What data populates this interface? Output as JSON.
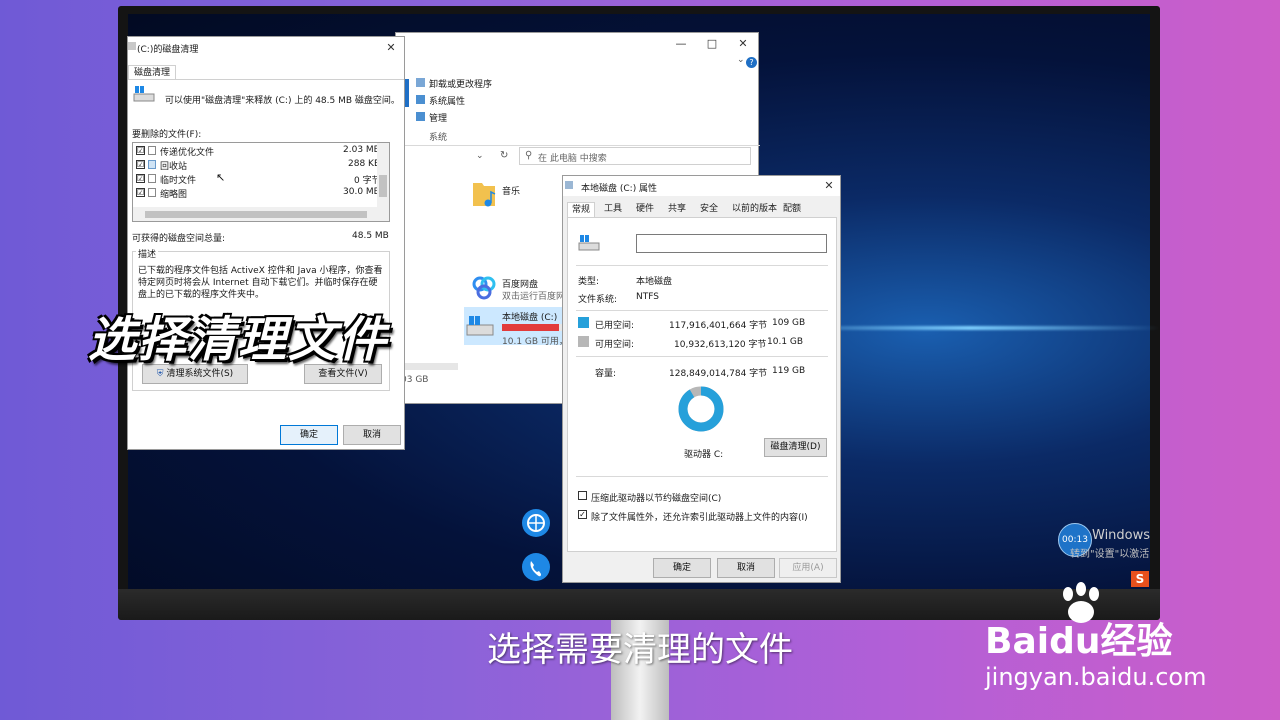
{
  "disk_cleanup": {
    "title": "(C:)的磁盘清理",
    "tab": "磁盘清理",
    "intro": "可以使用\"磁盘清理\"来释放  (C:) 上的 48.5 MB 磁盘空间。",
    "files_label": "要删除的文件(F):",
    "files": [
      {
        "name": "传递优化文件",
        "size": "2.03 MB",
        "checked": "☑"
      },
      {
        "name": "回收站",
        "size": "288 KB",
        "checked": "☑"
      },
      {
        "name": "临时文件",
        "size": "0 字节",
        "checked": "☑"
      },
      {
        "name": "缩略图",
        "size": "30.0 MB",
        "checked": "☑"
      }
    ],
    "total_label": "可获得的磁盘空间总量:",
    "total_value": "48.5 MB",
    "desc_label": "描述",
    "desc_text": "已下载的程序文件包括 ActiveX 控件和 Java 小程序，你查看特定网页时将会从 Internet 自动下载它们。并临时保存在硬盘上的已下载的程序文件夹中。",
    "clean_system_btn": "清理系统文件(S)",
    "view_files_btn": "查看文件(V)",
    "ok_btn": "确定",
    "cancel_btn": "取消"
  },
  "explorer": {
    "ribbon_items": [
      "卸载或更改程序",
      "系统属性",
      "管理"
    ],
    "ribbon_group": "系统",
    "search_placeholder": "在 此电脑 中搜索",
    "music": "音乐",
    "baidu_name": "百度网盘",
    "baidu_sub": "双击运行百度网",
    "disk_name": "本地磁盘 (C:)",
    "disk_free": "10.1 GB 可用，",
    "disk_free_partial": "03 GB",
    "disk_usage": 0.92
  },
  "properties": {
    "title": "本地磁盘 (C:) 属性",
    "tabs": [
      "常规",
      "工具",
      "硬件",
      "共享",
      "安全",
      "以前的版本",
      "配额"
    ],
    "type_label": "类型:",
    "type_value": "本地磁盘",
    "fs_label": "文件系统:",
    "fs_value": "NTFS",
    "used_label": "已用空间:",
    "used_bytes": "117,916,401,664 字节",
    "used_gb": "109 GB",
    "free_label": "可用空间:",
    "free_bytes": "10,932,613,120 字节",
    "free_gb": "10.1 GB",
    "capacity_label": "容量:",
    "capacity_bytes": "128,849,014,784 字节",
    "capacity_gb": "119 GB",
    "drive_label": "驱动器 C:",
    "cleanup_btn": "磁盘清理(D)",
    "compress_label": "压缩此驱动器以节约磁盘空间(C)",
    "index_label": "除了文件属性外，还允许索引此驱动器上文件的内容(I)",
    "ok_btn": "确定",
    "cancel_btn": "取消",
    "apply_btn": "应用(A)",
    "used_fraction": 0.915,
    "used_color": "#26a0da",
    "free_color": "#b7b7b7"
  },
  "desktop": {
    "timer": "00:13",
    "windows_text": "Windows",
    "activate_text": "转到\"设置\"以激活 W"
  },
  "overlay_title": "选择清理文件",
  "subtitle": "选择需要清理的文件",
  "watermark": {
    "brand": "Baidu经验",
    "url": "jingyan.baidu.com"
  }
}
